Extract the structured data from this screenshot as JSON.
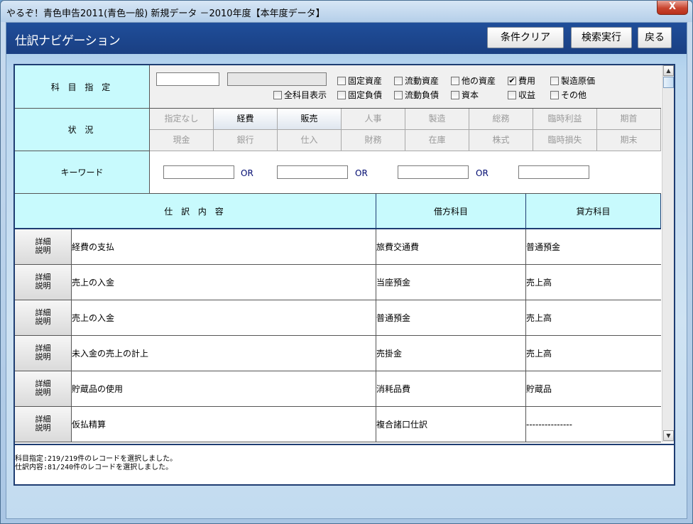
{
  "window": {
    "title": "やるぞ！青色申告2011(青色一般)   新規データ   －2010年度【本年度データ】",
    "close_label": "X"
  },
  "header": {
    "title": "仕訳ナビゲーション",
    "buttons": {
      "clear": "条件クリア",
      "search": "検索実行",
      "back": "戻る"
    }
  },
  "filter": {
    "subject_label": "科 目 指 定",
    "status_label": "状 況",
    "keyword_label": "キーワード",
    "checkboxes": {
      "fixed_assets": "固定資産",
      "current_assets": "流動資産",
      "other_assets": "他の資産",
      "expense": "費用",
      "mfg_cost": "製造原価",
      "show_all": "全科目表示",
      "fixed_liab": "固定負債",
      "current_liab": "流動負債",
      "capital": "資本",
      "revenue": "収益",
      "other": "その他"
    },
    "expense_checked": true,
    "status_buttons_row1": [
      "指定なし",
      "経費",
      "販売",
      "人事",
      "製造",
      "総務",
      "臨時利益",
      "期首"
    ],
    "status_buttons_row2": [
      "現金",
      "銀行",
      "仕入",
      "財務",
      "在庫",
      "株式",
      "臨時損失",
      "期末"
    ],
    "or_label": "OR"
  },
  "table": {
    "headers": {
      "content": "仕 訳 内 容",
      "debit": "借方科目",
      "credit": "貸方科目"
    },
    "detail_label_1": "詳細",
    "detail_label_2": "説明",
    "rows": [
      {
        "content": "経費の支払",
        "debit": "旅費交通費",
        "credit": "普通預金"
      },
      {
        "content": "売上の入金",
        "debit": "当座預金",
        "credit": "売上高"
      },
      {
        "content": "売上の入金",
        "debit": "普通預金",
        "credit": "売上高"
      },
      {
        "content": "未入金の売上の計上",
        "debit": "売掛金",
        "credit": "売上高"
      },
      {
        "content": "貯蔵品の使用",
        "debit": "消耗品費",
        "credit": "貯蔵品"
      },
      {
        "content": "仮払精算",
        "debit": "複合諸口仕訳",
        "credit": "---------------"
      }
    ]
  },
  "status_lines": [
    "科目指定:219/219件のレコードを選択しました。",
    "仕訳内容:81/240件のレコードを選択しました。"
  ],
  "icons": {
    "scroll_up": "scroll-up-arrow-icon",
    "scroll_down": "scroll-down-arrow-icon",
    "check": "checkmark-icon"
  }
}
